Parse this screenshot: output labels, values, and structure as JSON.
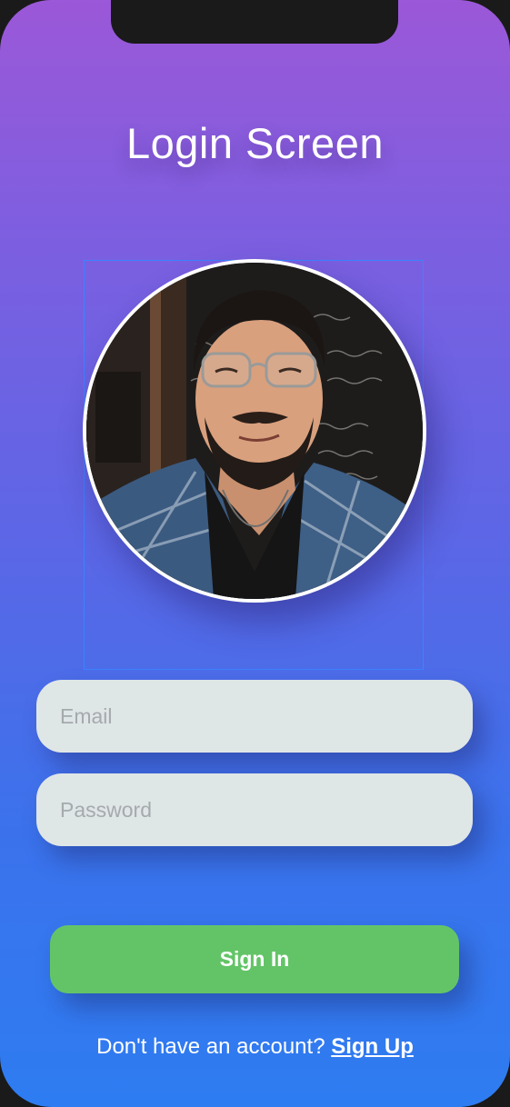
{
  "screen": {
    "title": "Login Screen"
  },
  "profile": {
    "avatar_icon": "profile-photo"
  },
  "form": {
    "email_placeholder": "Email",
    "password_placeholder": "Password",
    "email_value": "",
    "password_value": ""
  },
  "actions": {
    "signin_label": "Sign In"
  },
  "footer": {
    "prompt_text": "Don't have an account?",
    "signup_label": "Sign Up"
  },
  "colors": {
    "gradient_top": "#9b58d8",
    "gradient_bottom": "#2e7cf1",
    "input_background": "#dfe6e6",
    "button_green": "#63c467"
  }
}
